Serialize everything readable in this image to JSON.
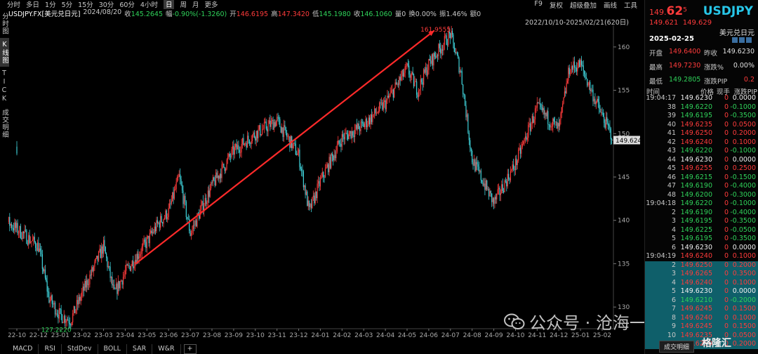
{
  "periods": [
    "分时",
    "多日",
    "1分",
    "5分",
    "15分",
    "30分",
    "60分",
    "4小时",
    "日",
    "周",
    "月",
    "更多"
  ],
  "active_period": "日",
  "toolbar_right": [
    "F9",
    "复权",
    "超级叠加",
    "画线",
    "工具"
  ],
  "info": {
    "symbol": "USDJPY.FX[美元兑日元]",
    "date": "2024/08/20",
    "close_label": "收",
    "close": "145.2645",
    "change_label": "幅",
    "change": "-0.90%(-1.3260)",
    "open_label": "开",
    "open": "146.6195",
    "high_label": "高",
    "high": "147.3420",
    "low_label": "低",
    "low": "145.1980",
    "last_label": "收",
    "last": "146.1060",
    "vol_label": "量",
    "vol": "0",
    "turnover_label": "换",
    "turnover": "0.00%",
    "amp_label": "振",
    "amp": "1.46%",
    "amount_label": "额",
    "amount": "0"
  },
  "vtabs": [
    "分时图",
    "K线图",
    "TICK",
    "成交明细"
  ],
  "date_range": "2022/10/10-2025/02/21(620日)",
  "indicator_tabs": [
    "MACD",
    "RSI",
    "StdDev",
    "BOLL",
    "SAR",
    "W&R"
  ],
  "chart_data": {
    "type": "candlestick",
    "y_ticks": [
      130,
      135,
      140,
      145,
      150,
      155,
      160
    ],
    "x_ticks": [
      "22-10",
      "22-12",
      "23-01",
      "23-02",
      "23-03",
      "23-04",
      "23-05",
      "23-06",
      "23-07",
      "23-08",
      "23-09",
      "23-10",
      "23-11",
      "23-12",
      "24-01",
      "24-02",
      "24-03",
      "24-04",
      "24-05",
      "24-06",
      "24-07",
      "24-08",
      "24-09",
      "24-10",
      "24-11",
      "24-12",
      "25-01",
      "25-02"
    ],
    "ylim": [
      127.5,
      162.5
    ],
    "max_label": "161.9555",
    "min_label": "127.2220",
    "current_price_label": "149.624",
    "path": [
      [
        "22-10",
        148.5
      ],
      [
        "22-11",
        150.5
      ],
      [
        "22-11",
        140.0
      ],
      [
        "22-12",
        137.0
      ],
      [
        "22-12",
        131.0
      ],
      [
        "23-01",
        129.0
      ],
      [
        "23-01",
        128.5
      ],
      [
        "23-02",
        131.5
      ],
      [
        "23-03",
        137.0
      ],
      [
        "23-03",
        131.5
      ],
      [
        "23-04",
        134.0
      ],
      [
        "23-05",
        137.5
      ],
      [
        "23-05",
        139.5
      ],
      [
        "23-06",
        141.0
      ],
      [
        "23-06",
        145.0
      ],
      [
        "23-07",
        138.5
      ],
      [
        "23-08",
        144.0
      ],
      [
        "23-09",
        148.0
      ],
      [
        "23-10",
        150.0
      ],
      [
        "23-11",
        151.5
      ],
      [
        "23-12",
        147.5
      ],
      [
        "23-12",
        141.0
      ],
      [
        "24-01",
        144.5
      ],
      [
        "24-02",
        149.5
      ],
      [
        "24-03",
        151.0
      ],
      [
        "24-04",
        153.5
      ],
      [
        "24-05",
        157.5
      ],
      [
        "24-05",
        155.0
      ],
      [
        "24-06",
        158.0
      ],
      [
        "24-07",
        161.5
      ],
      [
        "24-07",
        157.0
      ],
      [
        "24-08",
        147.0
      ],
      [
        "24-09",
        142.0
      ],
      [
        "24-10",
        146.5
      ],
      [
        "24-11",
        153.0
      ],
      [
        "24-12",
        150.5
      ],
      [
        "24-12",
        157.5
      ],
      [
        "25-01",
        158.0
      ],
      [
        "25-01",
        155.0
      ],
      [
        "25-02",
        152.0
      ],
      [
        "25-02",
        149.6
      ]
    ]
  },
  "annotation_arrow": {
    "from": [
      "23-04",
      135.0
    ],
    "to": [
      "24-06",
      161.9
    ]
  },
  "panel": {
    "price_small": "149.",
    "price_big": "62",
    "price_sup": "5",
    "symbol": "USDJPY",
    "bid": "149.621",
    "ask": "149.629",
    "name": "美元兑日元",
    "date": "2025-02-25",
    "stats": [
      {
        "label": "开盘",
        "value": "149.6400",
        "color": "#ff3b3b"
      },
      {
        "label": "昨收",
        "value": "149.6230",
        "color": "#e0e0e0"
      },
      {
        "label": "最高",
        "value": "149.7230",
        "color": "#ff3b3b"
      },
      {
        "label": "涨跌%",
        "value": "0.00%",
        "color": "#e0e0e0"
      },
      {
        "label": "最低",
        "value": "149.2805",
        "color": "#2fd25a"
      },
      {
        "label": "涨跌PIP",
        "value": "0.2",
        "color": "#ff3b3b"
      }
    ],
    "trade_headers": [
      "时间",
      "价格",
      "现手",
      "涨跌PIP"
    ],
    "trades": [
      {
        "t": "19:04:17",
        "p": "149.6230",
        "v": "0",
        "c": "0.0000",
        "col": "w"
      },
      {
        "t": "38",
        "p": "149.6220",
        "v": "0",
        "c": "-0.1000",
        "col": "g"
      },
      {
        "t": "39",
        "p": "149.6195",
        "v": "0",
        "c": "-0.3500",
        "col": "g"
      },
      {
        "t": "40",
        "p": "149.6235",
        "v": "0",
        "c": "0.0500",
        "col": "r"
      },
      {
        "t": "41",
        "p": "149.6250",
        "v": "0",
        "c": "0.2000",
        "col": "r"
      },
      {
        "t": "42",
        "p": "149.6240",
        "v": "0",
        "c": "0.1000",
        "col": "r"
      },
      {
        "t": "43",
        "p": "149.6220",
        "v": "0",
        "c": "-0.1000",
        "col": "g"
      },
      {
        "t": "44",
        "p": "149.6230",
        "v": "0",
        "c": "0.0000",
        "col": "w"
      },
      {
        "t": "45",
        "p": "149.6255",
        "v": "0",
        "c": "0.2500",
        "col": "r"
      },
      {
        "t": "46",
        "p": "149.6215",
        "v": "0",
        "c": "-0.1500",
        "col": "g"
      },
      {
        "t": "47",
        "p": "149.6190",
        "v": "0",
        "c": "-0.4000",
        "col": "g"
      },
      {
        "t": "48",
        "p": "149.6200",
        "v": "0",
        "c": "-0.3000",
        "col": "g"
      },
      {
        "t": "19:04:18",
        "p": "149.6220",
        "v": "0",
        "c": "-0.1000",
        "col": "g"
      },
      {
        "t": "2",
        "p": "149.6190",
        "v": "0",
        "c": "-0.4000",
        "col": "g"
      },
      {
        "t": "3",
        "p": "149.6195",
        "v": "0",
        "c": "-0.3500",
        "col": "g"
      },
      {
        "t": "4",
        "p": "149.6225",
        "v": "0",
        "c": "-0.0500",
        "col": "g"
      },
      {
        "t": "5",
        "p": "149.6195",
        "v": "0",
        "c": "-0.3500",
        "col": "g"
      },
      {
        "t": "6",
        "p": "149.6230",
        "v": "0",
        "c": "0.0000",
        "col": "w"
      },
      {
        "t": "19:04:19",
        "p": "149.6240",
        "v": "0",
        "c": "0.1000",
        "col": "r"
      },
      {
        "t": "2",
        "p": "149.6250",
        "v": "0",
        "c": "0.2000",
        "col": "r"
      },
      {
        "t": "3",
        "p": "149.6265",
        "v": "0",
        "c": "0.3500",
        "col": "r"
      },
      {
        "t": "4",
        "p": "149.6240",
        "v": "0",
        "c": "0.1000",
        "col": "r"
      },
      {
        "t": "5",
        "p": "149.6230",
        "v": "0",
        "c": "0.0000",
        "col": "w"
      },
      {
        "t": "6",
        "p": "149.6210",
        "v": "0",
        "c": "-0.2000",
        "col": "g"
      },
      {
        "t": "7",
        "p": "149.6245",
        "v": "0",
        "c": "0.1500",
        "col": "r"
      },
      {
        "t": "8",
        "p": "149.6240",
        "v": "0",
        "c": "0.1000",
        "col": "r"
      },
      {
        "t": "9",
        "p": "149.6245",
        "v": "0",
        "c": "0.1500",
        "col": "r"
      },
      {
        "t": "10",
        "p": "149.6235",
        "v": "0",
        "c": "0.0500",
        "col": "r"
      },
      {
        "t": "11",
        "p": "149.6250",
        "v": "0",
        "c": "0.2000",
        "col": "r"
      }
    ],
    "bottom_button": "成交明细"
  },
  "watermark": "公众号 · 沧海一土狗",
  "brand": "格隆汇",
  "colors": {
    "up": "#ff3b3b",
    "down": "#3fd0d8",
    "accent": "#27c6e8",
    "highlight": "#0f5f6a"
  }
}
